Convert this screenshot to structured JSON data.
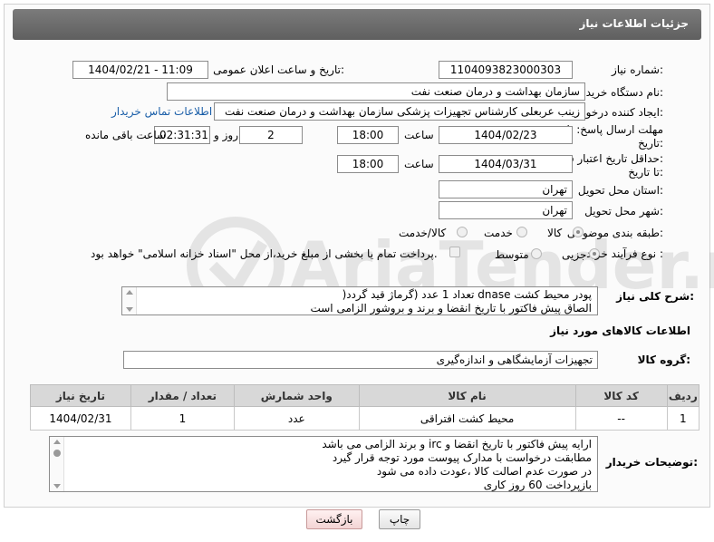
{
  "header": {
    "title": "جزئیات اطلاعات نیاز"
  },
  "fields": {
    "need_number_label": "شماره نیاز:",
    "need_number": "1104093823000303",
    "announce_label": "تاریخ و ساعت اعلان عمومی:",
    "announce_value": "1404/02/21 - 11:09",
    "buyer_org_label": "نام دستگاه خریدار:",
    "buyer_org": "سازمان بهداشت و درمان صنعت نفت",
    "requester_label": "ایجاد کننده درخواست:",
    "requester": "زینب عربعلی کارشناس تجهیزات پزشکی سازمان بهداشت و درمان صنعت نفت",
    "contact_link": "اطلاعات تماس خریدار",
    "deadline_label_1": "مهلت ارسال پاسخ: تا",
    "deadline_label_2": "تاریخ:",
    "deadline_date": "1404/02/23",
    "time_label": "ساعت",
    "deadline_time": "18:00",
    "days_value": "2",
    "days_label": "روز و",
    "remaining_value": "02:31:31",
    "remaining_label": "ساعت باقی مانده",
    "validity_label_1": "حداقل تاریخ اعتبار قیمت:",
    "validity_label_2": "تا تاریخ:",
    "validity_date": "1404/03/31",
    "validity_time": "18:00",
    "province_label": "استان محل تحویل:",
    "province": "تهران",
    "city_label": "شهر محل تحویل:",
    "city": "تهران",
    "category_label": "طبقه بندی موضوعی:",
    "category_options": [
      "کالا",
      "خدمت",
      "کالا/خدمت"
    ],
    "category_selected": "کالا",
    "purchase_type_label": "نوع فرآیند خرید :",
    "purchase_options": [
      "جزیی",
      "متوسط"
    ],
    "purchase_selected": "جزیی",
    "treasury_note": "پرداخت تمام یا بخشی از مبلغ خرید،از محل \"اسناد خزانه اسلامی\" خواهد بود."
  },
  "description": {
    "label": "شرح کلی نیاز:",
    "lines": [
      "پودر محیط  کشت dnase  تعداد 1 عدد (گرماژ قید گردد(",
      "الصاق پیش فاکتور با تاریخ انقضا و برند و بروشور الزامی است"
    ]
  },
  "goods": {
    "section_title": "اطلاعات کالاهای مورد نیاز",
    "group_label": "گروه کالا:",
    "group_value": "تجهیزات آزمایشگاهی و اندازه‌گیری",
    "table": {
      "headers": [
        "ردیف",
        "کد کالا",
        "نام کالا",
        "واحد شمارش",
        "تعداد / مقدار",
        "تاریخ نیاز"
      ],
      "rows": [
        [
          "1",
          "--",
          "محیط کشت افتراقی",
          "عدد",
          "1",
          "1404/02/31"
        ]
      ]
    }
  },
  "buyer_notes": {
    "label": "توضیحات خریدار:",
    "lines": [
      "ارایه  پیش فاکتور با تاریخ انقضا و irc  و برند الزامی می باشد",
      "مطابقت درخواست با مدارک پیوست مورد توجه قرار گیرد",
      "در صورت عدم اصالت کالا ،عودت داده می شود",
      "بازپرداخت 60 روز کاری"
    ]
  },
  "buttons": {
    "print": "چاپ",
    "back": "بازگشت"
  }
}
